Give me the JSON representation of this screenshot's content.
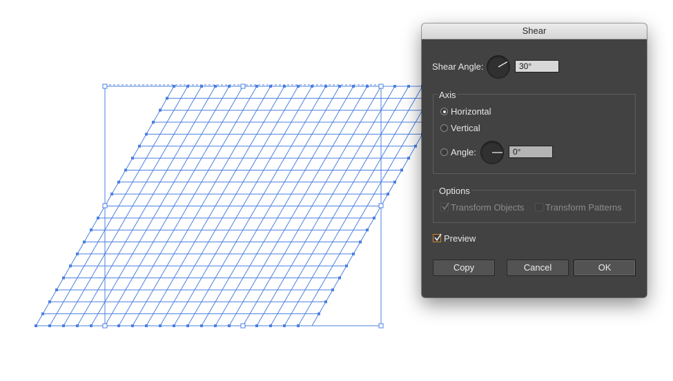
{
  "dialog": {
    "title": "Shear",
    "shear_angle_label": "Shear Angle:",
    "shear_angle_value": "30°",
    "axis": {
      "title": "Axis",
      "horizontal_label": "Horizontal",
      "vertical_label": "Vertical",
      "angle_label": "Angle:",
      "angle_value": "0°",
      "selected": "horizontal"
    },
    "options": {
      "title": "Options",
      "transform_objects_label": "Transform Objects",
      "transform_objects_checked": true,
      "transform_patterns_label": "Transform Patterns",
      "transform_patterns_checked": false
    },
    "preview_label": "Preview",
    "preview_checked": true,
    "buttons": {
      "copy": "Copy",
      "cancel": "Cancel",
      "ok": "OK"
    }
  },
  "canvas": {
    "selection_color": "#4a7fe0",
    "grid_rows": 20,
    "grid_cols": 20
  }
}
